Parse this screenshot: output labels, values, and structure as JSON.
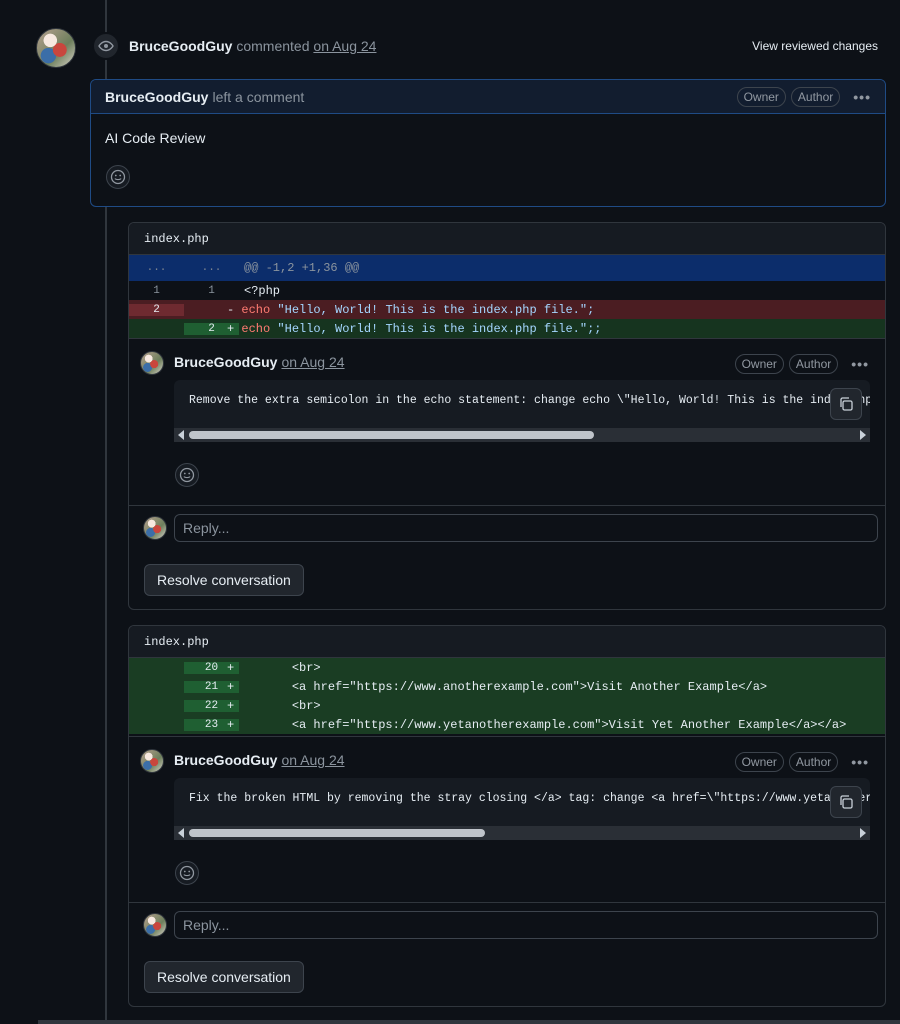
{
  "review": {
    "user": "BruceGoodGuy",
    "action": "commented",
    "date": "on Aug 24",
    "view_changes": "View reviewed changes",
    "comment_action": "left a comment",
    "badge_owner": "Owner",
    "badge_author": "Author",
    "body": "AI Code Review"
  },
  "threads": [
    {
      "file": "index.php",
      "hunk": {
        "old": "...",
        "new": "...",
        "text": "@@ -1,2 +1,36 @@"
      },
      "lines": [
        {
          "old": "1",
          "new": "1",
          "sign": "",
          "type": "ctx",
          "code": "<?php"
        },
        {
          "old": "2",
          "new": "",
          "sign": "-",
          "type": "del",
          "code_kw": "echo",
          "code_str": " \"Hello, World! This is the index.php file.\";"
        },
        {
          "old": "",
          "new": "2",
          "sign": "+",
          "type": "add",
          "code_kw": "echo",
          "code_str": " \"Hello, World! This is the index.php file.\";;"
        }
      ],
      "comment": {
        "user": "BruceGoodGuy",
        "date": "on Aug 24",
        "text": "Remove the extra semicolon in the echo statement: change echo \\\"Hello, World! This is the index.php f",
        "scroll_fraction": 0.6
      },
      "reply_placeholder": "Reply...",
      "resolve_label": "Resolve conversation"
    },
    {
      "file": "index.php",
      "lines": [
        {
          "new": "20",
          "sign": "+",
          "code": "    <br>"
        },
        {
          "new": "21",
          "sign": "+",
          "code": "    <a href=\"https://www.anotherexample.com\">Visit Another Example</a>"
        },
        {
          "new": "22",
          "sign": "+",
          "code": "    <br>"
        },
        {
          "new": "23",
          "sign": "+",
          "code": "    <a href=\"https://www.yetanotherexample.com\">Visit Yet Another Example</a></a>"
        }
      ],
      "comment": {
        "user": "BruceGoodGuy",
        "date": "on Aug 24",
        "text": "Fix the broken HTML by removing the stray closing </a> tag: change <a href=\\\"https://www.yetanotherex",
        "scroll_fraction": 0.45
      },
      "reply_placeholder": "Reply...",
      "resolve_label": "Resolve conversation"
    }
  ],
  "colors": {
    "background": "#0d1117",
    "accent_border": "#1f4b85",
    "deletion": "#4b1d22",
    "addition": "#16341f"
  },
  "icons": [
    "eye-icon",
    "smiley-icon",
    "copy-icon",
    "kebab-icon"
  ]
}
